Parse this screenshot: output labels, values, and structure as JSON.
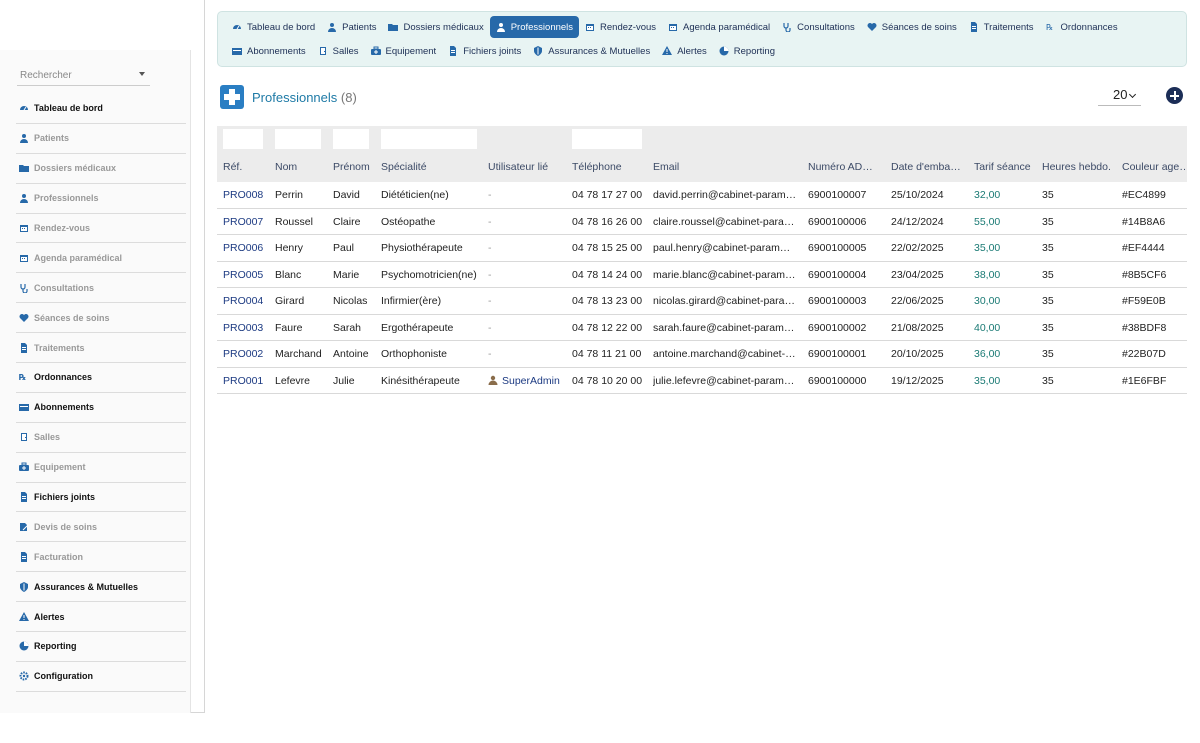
{
  "sidebar": {
    "search_placeholder": "Rechercher",
    "items": [
      {
        "label": "Tableau de bord",
        "icon": "dashboard-icon",
        "strong": true
      },
      {
        "label": "Patients",
        "icon": "user-icon",
        "strong": false
      },
      {
        "label": "Dossiers médicaux",
        "icon": "folder-icon",
        "strong": false
      },
      {
        "label": "Professionnels",
        "icon": "user-md-icon",
        "strong": false
      },
      {
        "label": "Rendez-vous",
        "icon": "calendar-check-icon",
        "strong": false
      },
      {
        "label": "Agenda paramédical",
        "icon": "calendar-icon",
        "strong": false
      },
      {
        "label": "Consultations",
        "icon": "stethoscope-icon",
        "strong": false
      },
      {
        "label": "Séances de soins",
        "icon": "heart-icon",
        "strong": false
      },
      {
        "label": "Traitements",
        "icon": "pill-icon",
        "strong": false
      },
      {
        "label": "Ordonnances",
        "icon": "prescription-icon",
        "strong": true
      },
      {
        "label": "Abonnements",
        "icon": "card-icon",
        "strong": true
      },
      {
        "label": "Salles",
        "icon": "door-icon",
        "strong": false
      },
      {
        "label": "Equipement",
        "icon": "medkit-icon",
        "strong": false
      },
      {
        "label": "Fichiers joints",
        "icon": "file-icon",
        "strong": true
      },
      {
        "label": "Devis de soins",
        "icon": "edit-file-icon",
        "strong": false
      },
      {
        "label": "Facturation",
        "icon": "invoice-icon",
        "strong": false
      },
      {
        "label": "Assurances & Mutuelles",
        "icon": "shield-icon",
        "strong": true
      },
      {
        "label": "Alertes",
        "icon": "warning-icon",
        "strong": true
      },
      {
        "label": "Reporting",
        "icon": "chart-pie-icon",
        "strong": true
      },
      {
        "label": "Configuration",
        "icon": "gear-icon",
        "strong": true
      }
    ]
  },
  "topnav": {
    "row1": [
      {
        "label": "Tableau de bord",
        "icon": "dashboard-icon",
        "active": false
      },
      {
        "label": "Patients",
        "icon": "user-icon",
        "active": false
      },
      {
        "label": "Dossiers médicaux",
        "icon": "folder-icon",
        "active": false
      },
      {
        "label": "Professionnels",
        "icon": "user-md-icon",
        "active": true
      },
      {
        "label": "Rendez-vous",
        "icon": "calendar-check-icon",
        "active": false
      },
      {
        "label": "Agenda paramédical",
        "icon": "calendar-icon",
        "active": false
      },
      {
        "label": "Consultations",
        "icon": "stethoscope-icon",
        "active": false
      },
      {
        "label": "Séances de soins",
        "icon": "heart-icon",
        "active": false
      },
      {
        "label": "Traitements",
        "icon": "pill-icon",
        "active": false
      },
      {
        "label": "Ordonnances",
        "icon": "prescription-icon",
        "active": false
      }
    ],
    "row2": [
      {
        "label": "Abonnements",
        "icon": "card-icon",
        "active": false
      },
      {
        "label": "Salles",
        "icon": "door-icon",
        "active": false
      },
      {
        "label": "Equipement",
        "icon": "medkit-icon",
        "active": false
      },
      {
        "label": "Fichiers joints",
        "icon": "file-icon",
        "active": false
      },
      {
        "label": "Assurances & Mutuelles",
        "icon": "shield-icon",
        "active": false
      },
      {
        "label": "Alertes",
        "icon": "warning-icon",
        "active": false
      },
      {
        "label": "Reporting",
        "icon": "chart-pie-icon",
        "active": false
      }
    ]
  },
  "page": {
    "title": "Professionnels",
    "count": "(8)",
    "page_size": "20"
  },
  "table": {
    "columns": [
      "Réf.",
      "Nom",
      "Prénom",
      "Spécialité",
      "Utilisateur lié",
      "Téléphone",
      "Email",
      "Numéro AD…",
      "Date d'emba…",
      "Tarif séance",
      "Heures hebdo.",
      "Couleur age…"
    ],
    "rows": [
      {
        "ref": "PRO008",
        "nom": "Perrin",
        "prenom": "David",
        "specialite": "Diététicien(ne)",
        "utilisateur": "-",
        "telephone": "04 78 17 27 00",
        "email": "david.perrin@cabinet-param…",
        "adeli": "6900100007",
        "date": "25/10/2024",
        "tarif": "32,00",
        "heures": "35",
        "couleur": "#EC4899"
      },
      {
        "ref": "PRO007",
        "nom": "Roussel",
        "prenom": "Claire",
        "specialite": "Ostéopathe",
        "utilisateur": "-",
        "telephone": "04 78 16 26 00",
        "email": "claire.roussel@cabinet-para…",
        "adeli": "6900100006",
        "date": "24/12/2024",
        "tarif": "55,00",
        "heures": "35",
        "couleur": "#14B8A6"
      },
      {
        "ref": "PRO006",
        "nom": "Henry",
        "prenom": "Paul",
        "specialite": "Physiothérapeute",
        "utilisateur": "-",
        "telephone": "04 78 15 25 00",
        "email": "paul.henry@cabinet-param…",
        "adeli": "6900100005",
        "date": "22/02/2025",
        "tarif": "35,00",
        "heures": "35",
        "couleur": "#EF4444"
      },
      {
        "ref": "PRO005",
        "nom": "Blanc",
        "prenom": "Marie",
        "specialite": "Psychomotricien(ne)",
        "utilisateur": "-",
        "telephone": "04 78 14 24 00",
        "email": "marie.blanc@cabinet-param…",
        "adeli": "6900100004",
        "date": "23/04/2025",
        "tarif": "38,00",
        "heures": "35",
        "couleur": "#8B5CF6"
      },
      {
        "ref": "PRO004",
        "nom": "Girard",
        "prenom": "Nicolas",
        "specialite": "Infirmier(ère)",
        "utilisateur": "-",
        "telephone": "04 78 13 23 00",
        "email": "nicolas.girard@cabinet-para…",
        "adeli": "6900100003",
        "date": "22/06/2025",
        "tarif": "30,00",
        "heures": "35",
        "couleur": "#F59E0B"
      },
      {
        "ref": "PRO003",
        "nom": "Faure",
        "prenom": "Sarah",
        "specialite": "Ergothérapeute",
        "utilisateur": "-",
        "telephone": "04 78 12 22 00",
        "email": "sarah.faure@cabinet-param…",
        "adeli": "6900100002",
        "date": "21/08/2025",
        "tarif": "40,00",
        "heures": "35",
        "couleur": "#38BDF8"
      },
      {
        "ref": "PRO002",
        "nom": "Marchand",
        "prenom": "Antoine",
        "specialite": "Orthophoniste",
        "utilisateur": "-",
        "telephone": "04 78 11 21 00",
        "email": "antoine.marchand@cabinet-…",
        "adeli": "6900100001",
        "date": "20/10/2025",
        "tarif": "36,00",
        "heures": "35",
        "couleur": "#22B07D"
      },
      {
        "ref": "PRO001",
        "nom": "Lefevre",
        "prenom": "Julie",
        "specialite": "Kinésithérapeute",
        "utilisateur": "SuperAdmin",
        "telephone": "04 78 10 20 00",
        "email": "julie.lefevre@cabinet-param…",
        "adeli": "6900100000",
        "date": "19/12/2025",
        "tarif": "35,00",
        "heures": "35",
        "couleur": "#1E6FBF"
      }
    ]
  },
  "colors": {
    "accent": "#2769a9",
    "nav_bg": "#e8f4f3",
    "link": "#1c3a82",
    "tarif": "#1a7a74",
    "title": "#1e7aa6"
  }
}
